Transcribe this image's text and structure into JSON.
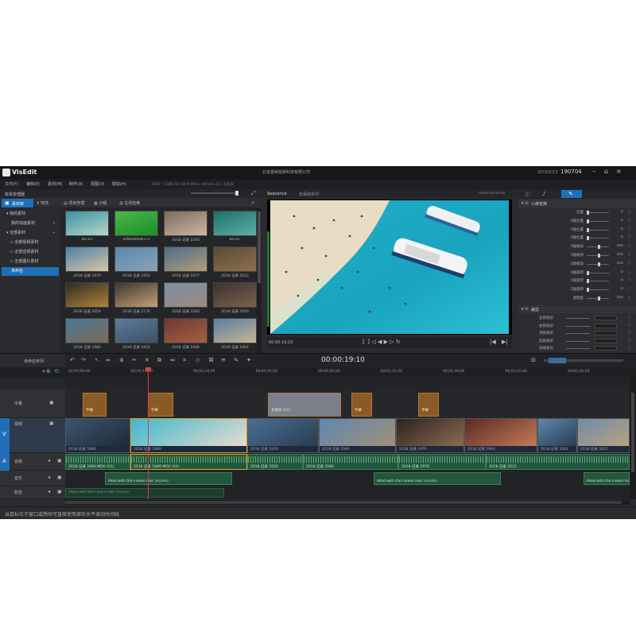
{
  "app": {
    "logo": "VisEdit",
    "company": "北京曼纳视频科技有限公司",
    "date": "2019/2/12",
    "time": "190704",
    "window_buttons": [
      "–",
      "⌂",
      "×"
    ]
  },
  "menu": [
    "文件(F)",
    "编辑(E)",
    "素材(M)",
    "制作(A)",
    "视图(V)",
    "帮助(H)"
  ],
  "project_info": "1920 * 1080 50i 16:9 (PAL): 48 kHz 2ch 工程表",
  "media_panel": {
    "title": "故事管理器",
    "tabs": [
      "素材库",
      "特效",
      "项目管理",
      "分组",
      "在线检索"
    ],
    "tree": [
      "我的素材",
      "我的动画素材",
      "全部素材",
      "全部视频素材",
      "全部音频素材",
      "全部图片素材",
      "未命名"
    ],
    "thumbs": [
      {
        "cap": "BG-05",
        "colors": [
          "#3d8fa3",
          "#b7d7c9"
        ]
      },
      {
        "cap": "DANDB908173",
        "colors": [
          "#49b84a",
          "#1f8c2a"
        ]
      },
      {
        "cap": "2018 记录 2200",
        "colors": [
          "#7d6a5a",
          "#cdb7a3"
        ]
      },
      {
        "cap": "BG-07",
        "colors": [
          "#1c6f6c",
          "#5fb0a5"
        ]
      },
      {
        "cap": "2018 记录 1970",
        "colors": [
          "#4d80a8",
          "#d8c6a5"
        ]
      },
      {
        "cap": "2018 记录 1952",
        "colors": [
          "#5b87ad",
          "#8aa3b5"
        ]
      },
      {
        "cap": "2018 记录 1977",
        "colors": [
          "#4b6c8b",
          "#b49e74"
        ]
      },
      {
        "cap": "2018 记录 2012",
        "colors": [
          "#5c4a34",
          "#8d7050"
        ]
      },
      {
        "cap": "2018 记录 2054",
        "colors": [
          "#2f2b22",
          "#b1813c"
        ]
      },
      {
        "cap": "2018 记录 2176",
        "colors": [
          "#3d3530",
          "#c3a178"
        ]
      },
      {
        "cap": "2018 记录 2200",
        "colors": [
          "#7a8fa3",
          "#9b8b7e"
        ]
      },
      {
        "cap": "2018 记录 2016",
        "colors": [
          "#3a3230",
          "#7b624b"
        ]
      },
      {
        "cap": "2018 记录 1880",
        "colors": [
          "#4a7897",
          "#7c6a56"
        ]
      },
      {
        "cap": "2018 记录 1832",
        "colors": [
          "#5d7c9a",
          "#3d5063"
        ]
      },
      {
        "cap": "2018 记录 1936",
        "colors": [
          "#6a3b32",
          "#a85e43"
        ]
      },
      {
        "cap": "2018 记录 1902",
        "colors": [
          "#5a7fa0",
          "#c9b394"
        ]
      }
    ]
  },
  "preview": {
    "tabs": [
      "Sequence",
      "未保存序列"
    ],
    "timecode": "00:00:19:10",
    "duration": "0000:00:00:00",
    "end_tc": "00:00:19:10"
  },
  "properties": {
    "section1": "三维变换",
    "rows": [
      {
        "label": "位置",
        "value": "0"
      },
      {
        "label": "X轴位置",
        "value": "0"
      },
      {
        "label": "Y轴位置",
        "value": "0"
      },
      {
        "label": "Z轴位置",
        "value": "0"
      },
      {
        "label": "X轴缩放",
        "value": "100"
      },
      {
        "label": "Y轴缩放",
        "value": "100"
      },
      {
        "label": "Z轴缩放",
        "value": "100"
      },
      {
        "label": "X轴旋转",
        "value": "0"
      },
      {
        "label": "Y轴旋转",
        "value": "0"
      },
      {
        "label": "Z轴旋转",
        "value": "0"
      },
      {
        "label": "透明度",
        "value": "100"
      }
    ],
    "section2": "裁剪",
    "crop_rows": [
      "左侧裁剪",
      "右侧裁剪",
      "顶部裁剪",
      "底部裁剪",
      "边缘柔化"
    ]
  },
  "timeline": {
    "sequence_name": "未命名序列",
    "timecode": "00:00:19:10",
    "ruler": [
      "00;00;00;00",
      "00;00;15;00",
      "00;00;30;00",
      "00;00;45;00",
      "00;01;00;00",
      "00;01;15;00",
      "00;01;30;00",
      "00;01;45;00",
      "00;02;00;00"
    ],
    "tracks": [
      {
        "name": "字幕",
        "label": "字幕"
      },
      {
        "name": "视频",
        "label": "视频"
      },
      {
        "name": "音频",
        "label": "音频"
      },
      {
        "name": "音乐",
        "label": "音乐"
      },
      {
        "name": "配音",
        "label": "配音"
      }
    ],
    "v_label": "V",
    "a_label": "A",
    "title_clips": [
      {
        "text": "字幕"
      },
      {
        "text": "字幕"
      },
      {
        "text": "多媒体 5(0)"
      },
      {
        "text": "字幕"
      },
      {
        "text": "字幕"
      }
    ],
    "video_clips": [
      "2018 记录 1896",
      "2018 记录 1849",
      "2018 记录 1920",
      "2018 记录 1946",
      "2018 记录 1970",
      "2018 记录 1993",
      "2018 记录 2001",
      "2018 记录 2015"
    ],
    "audio_clips": [
      "2018 记录 1896.MOV (A1)",
      "2018 记录 1849.MOV (A1)",
      "2018 记录 1920",
      "2018 记录 1946",
      "2018 记录 1970",
      "2018 记录 2012"
    ],
    "music_clips": [
      "Maid with the Flaxen Hair (A1/A2)",
      "Maid with the Flaxen Hair (A1/A2)",
      "Maid with the Flaxen Hair"
    ],
    "voice_clip": "Maid with the Flaxen Hair (A1/A2)"
  },
  "status": "当鼠标位于窗口或感时可直接使用滚轮水平滚动时间线"
}
